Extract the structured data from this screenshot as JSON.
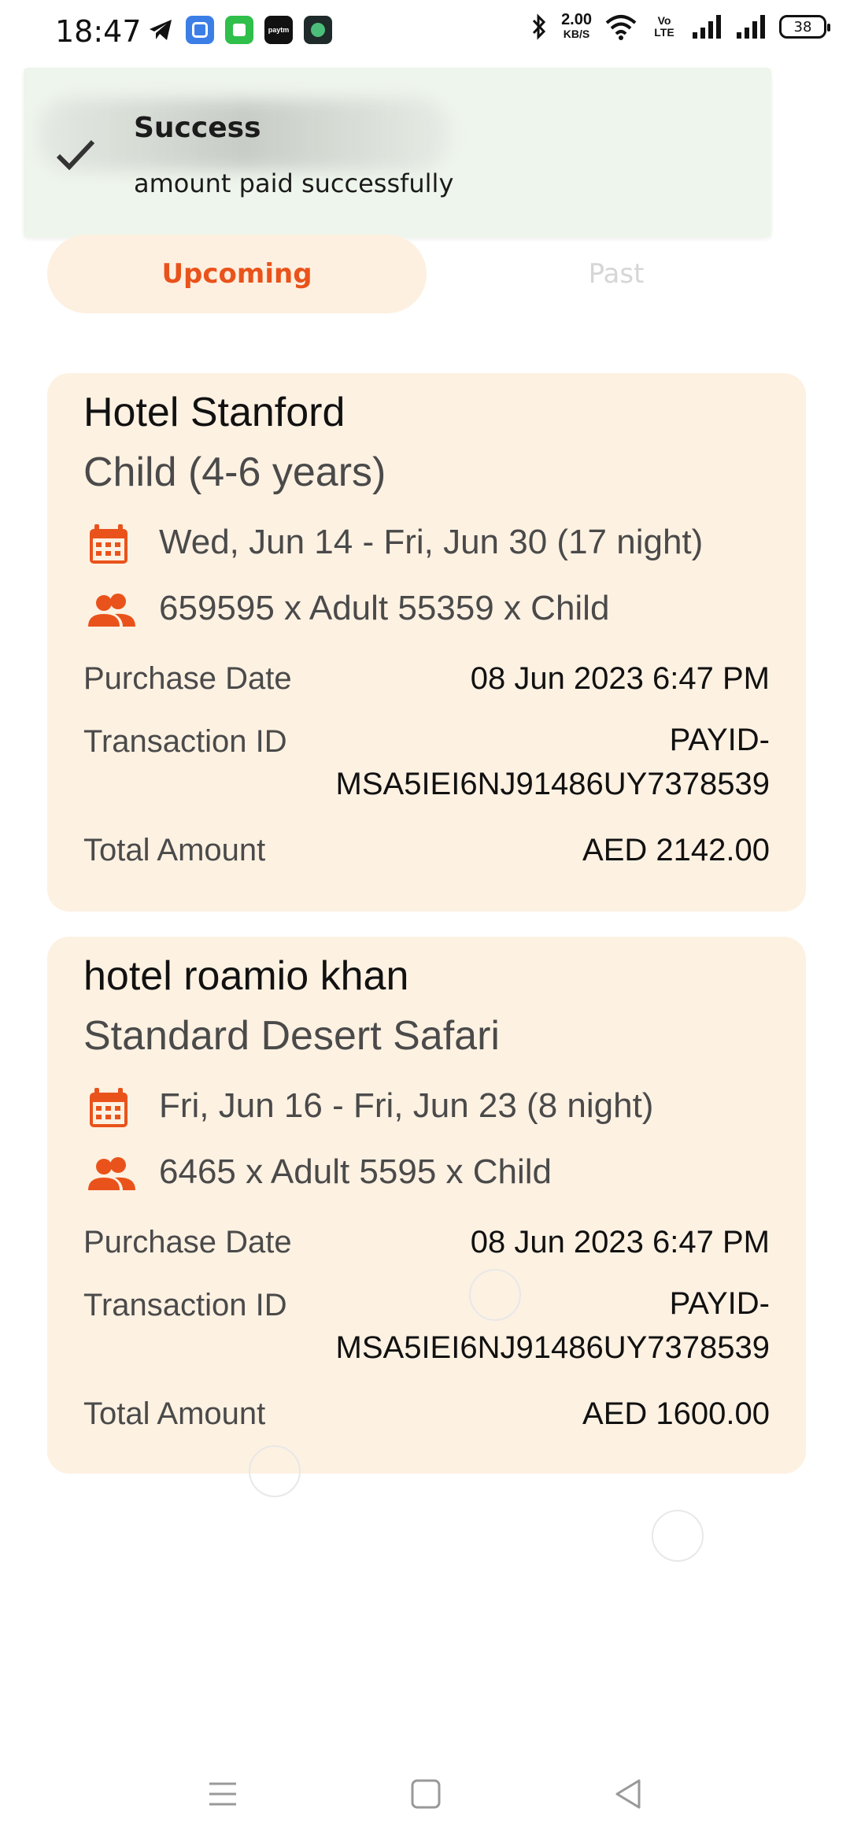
{
  "status_bar": {
    "time": "18:47",
    "net_speed_value": "2.00",
    "net_speed_unit": "KB/S",
    "volte": "Vo LTE",
    "battery": "38"
  },
  "toast": {
    "title": "Success",
    "message": "amount paid successfully"
  },
  "tabs": [
    {
      "label": "Upcoming",
      "active": true
    },
    {
      "label": "Past",
      "active": false
    }
  ],
  "bookings": [
    {
      "hotel": "Hotel Stanford",
      "package": "Child (4-6 years)",
      "dates": "Wed, Jun 14 -  Fri, Jun 30 (17 night)",
      "guests": "659595 x Adult   55359 x Child",
      "purchase_date_label": "Purchase Date",
      "purchase_date": "08 Jun 2023 6:47 PM",
      "transaction_label": "Transaction ID",
      "transaction_line1": "PAYID-",
      "transaction_line2": "MSA5IEI6NJ91486UY7378539",
      "total_label": "Total Amount",
      "total": "AED 2142.00"
    },
    {
      "hotel": "hotel roamio khan",
      "package": "Standard Desert Safari",
      "dates": "Fri, Jun 16 -  Fri, Jun 23 (8 night)",
      "guests": "6465 x Adult   5595 x Child",
      "purchase_date_label": "Purchase Date",
      "purchase_date": "08 Jun 2023 6:47 PM",
      "transaction_label": "Transaction ID",
      "transaction_line1": "PAYID-",
      "transaction_line2": "MSA5IEI6NJ91486UY7378539",
      "total_label": "Total Amount",
      "total": "AED 1600.00"
    }
  ],
  "colors": {
    "accent": "#e9531b",
    "card_bg": "#fdf1e2",
    "toast_bg": "#eef5ec"
  },
  "icons": {
    "calendar": "calendar-icon",
    "people": "people-icon",
    "check": "check-icon"
  }
}
